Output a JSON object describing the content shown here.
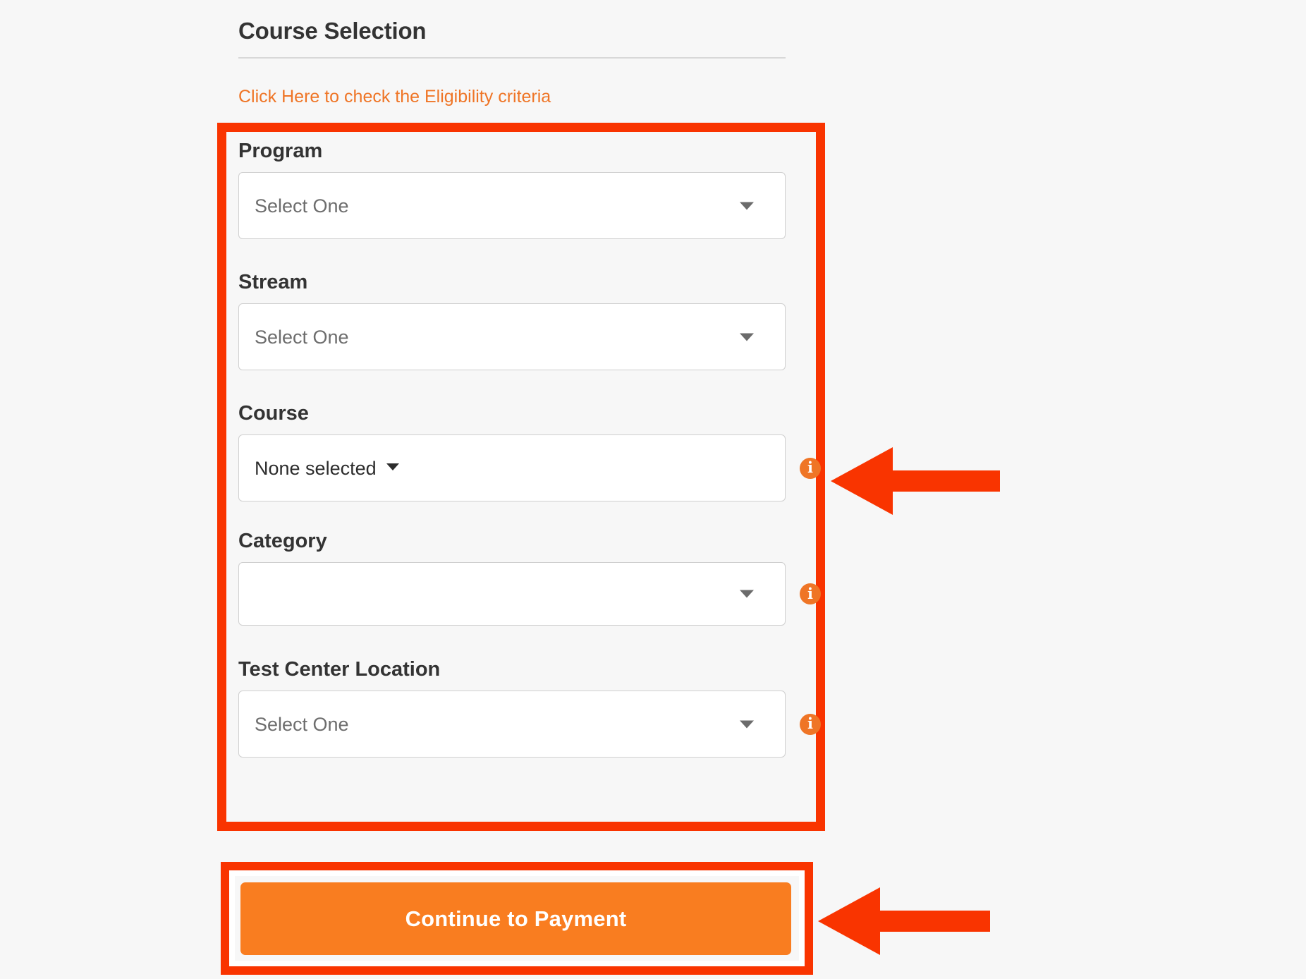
{
  "section": {
    "title": "Course Selection",
    "eligibility_link": "Click Here to check the Eligibility criteria"
  },
  "form": {
    "fields": [
      {
        "label": "Program",
        "value": "Select One",
        "control": "native-select",
        "has_info_icon": false
      },
      {
        "label": "Stream",
        "value": "Select One",
        "control": "native-select",
        "has_info_icon": false
      },
      {
        "label": "Course",
        "value": "None selected",
        "control": "multiselect-dropdown",
        "has_info_icon": true
      },
      {
        "label": "Category",
        "value": "",
        "control": "native-select",
        "has_info_icon": true
      },
      {
        "label": "Test Center Location",
        "value": "Select One",
        "control": "native-select",
        "has_info_icon": true
      }
    ]
  },
  "actions": {
    "continue_label": "Continue to Payment"
  },
  "icons": {
    "info": "i",
    "caret_down": "chevron-down-icon",
    "arrow_left": "arrow-left-icon"
  },
  "colors": {
    "page_background": "#f7f7f7",
    "accent_orange": "#ef7526",
    "button_orange": "#f97d20",
    "annotation_red": "#f93400",
    "text_dark": "#333333",
    "placeholder_gray": "#6d6d6d",
    "field_border": "#cfcfcf",
    "divider": "#d8d8d8"
  }
}
